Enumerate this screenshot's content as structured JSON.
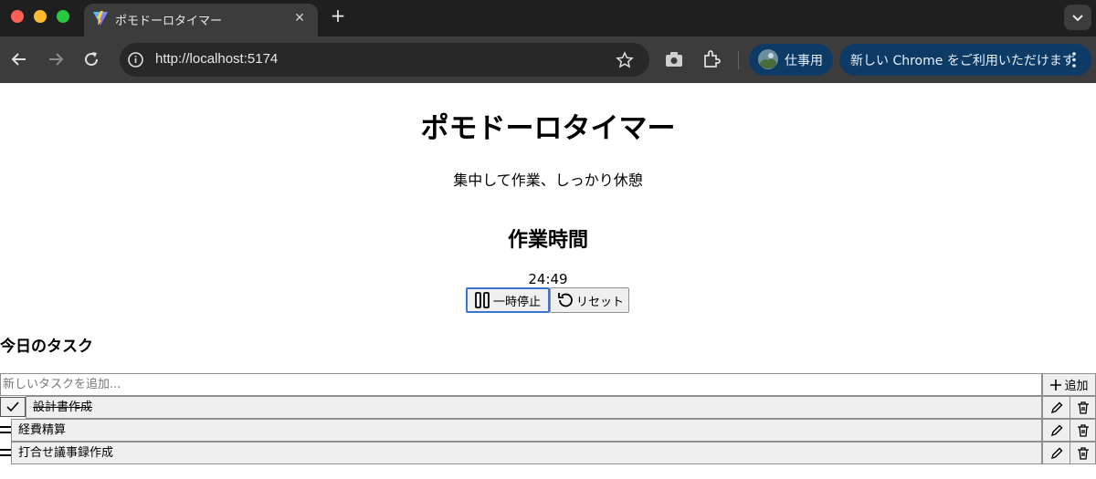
{
  "browser": {
    "tab_title": "ポモドーロタイマー",
    "tab_close": "✕",
    "new_tab": "+",
    "url": "http://localhost:5174",
    "profile_label": "仕事用",
    "update_label": "新しい Chrome をご利用いただけます",
    "colors": {
      "tabbar": "#1f1f1f",
      "toolbar": "#3c3c3c",
      "pill": "#0e3a66"
    }
  },
  "app": {
    "title": "ポモドーロタイマー",
    "subtitle": "集中して作業、しっかり休憩",
    "mode": "作業時間",
    "time": "24:49",
    "pause_label": "一時停止",
    "reset_label": "リセット"
  },
  "tasks": {
    "heading": "今日のタスク",
    "input_placeholder": "新しいタスクを追加...",
    "add_label": "追加",
    "items": [
      {
        "label": "設計書作成",
        "done": true
      },
      {
        "label": "経費精算",
        "done": false
      },
      {
        "label": "打合せ議事録作成",
        "done": false
      }
    ]
  },
  "icons": [
    "pause-icon",
    "reset-icon",
    "plus-icon",
    "check-icon",
    "pencil-icon",
    "trash-icon",
    "drag-handle-icon"
  ]
}
